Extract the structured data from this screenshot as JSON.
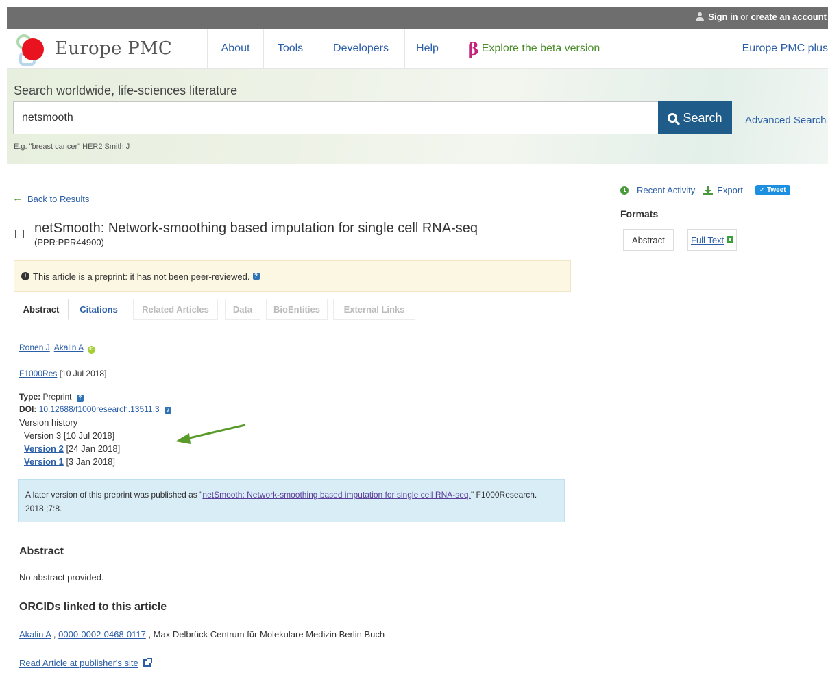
{
  "topbar": {
    "signin": "Sign in",
    "or": "or",
    "create": "create an account"
  },
  "header": {
    "brand": "Europe PMC",
    "nav": [
      "About",
      "Tools",
      "Developers",
      "Help"
    ],
    "beta_symbol": "β",
    "beta_label": "Explore the beta version",
    "plus_label": "Europe PMC plus"
  },
  "search": {
    "title": "Search worldwide, life-sciences literature",
    "value": "netsmooth",
    "button": "Search",
    "advanced": "Advanced Search",
    "example": "E.g. \"breast cancer\" HER2 Smith J"
  },
  "sidebar": {
    "recent": "Recent Activity",
    "export": "Export",
    "tweet": "Tweet",
    "formats_title": "Formats",
    "formats": [
      "Abstract",
      "Full Text"
    ]
  },
  "article": {
    "back": "Back to Results",
    "title": "netSmooth: Network-smoothing based imputation for single cell RNA-seq",
    "id": "(PPR:PPR44900)",
    "warning": "This article is a preprint: it has not been peer-reviewed.",
    "tabs": [
      "Abstract",
      "Citations",
      "Related Articles",
      "Data",
      "BioEntities",
      "External Links"
    ],
    "authors": [
      "Ronen J",
      "Akalin A"
    ],
    "journal": "F1000Res",
    "date": "[10 Jul 2018]",
    "type_label": "Type:",
    "type_value": "Preprint",
    "doi_label": "DOI:",
    "doi_value": "10.12688/f1000research.13511.3",
    "version_history": "Version history",
    "versions": [
      {
        "label": "Version 3",
        "date": "[10 Jul 2018]"
      },
      {
        "label": "Version 2",
        "date": "[24 Jan 2018]"
      },
      {
        "label": "Version 1",
        "date": "[3 Jan 2018]"
      }
    ],
    "later_prefix": "A later version of this preprint was published as \"",
    "later_link": "netSmooth: Network-smoothing based imputation for single cell RNA-seq.",
    "later_suffix": "\" F1000Research. 2018 ;7:8.",
    "abstract_heading": "Abstract",
    "abstract_text": "No abstract provided.",
    "orcid_heading": "ORCIDs linked to this article",
    "orcid_author": "Akalin A",
    "orcid_id": "0000-0002-0468-0117",
    "orcid_affil": ", Max Delbrück Centrum für Molekulare Medizin Berlin Buch",
    "read_link": "Read Article at publisher's site"
  },
  "annotation": {
    "arrow_color": "#5a9a2a"
  }
}
